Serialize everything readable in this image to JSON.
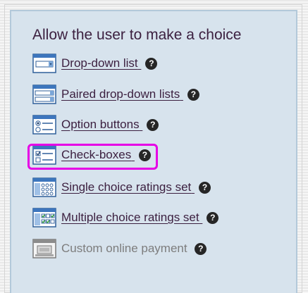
{
  "panel": {
    "title": "Allow the user to make a choice"
  },
  "items": [
    {
      "label": "Drop-down list",
      "icon": "drop-down-list-icon",
      "enabled": true,
      "highlighted": false
    },
    {
      "label": "Paired drop-down lists",
      "icon": "paired-drop-down-lists-icon",
      "enabled": true,
      "highlighted": false
    },
    {
      "label": "Option buttons",
      "icon": "option-buttons-icon",
      "enabled": true,
      "highlighted": false
    },
    {
      "label": "Check-boxes",
      "icon": "check-boxes-icon",
      "enabled": true,
      "highlighted": true
    },
    {
      "label": "Single choice ratings set",
      "icon": "single-choice-ratings-set-icon",
      "enabled": true,
      "highlighted": false
    },
    {
      "label": "Multiple choice ratings set",
      "icon": "multiple-choice-ratings-set-icon",
      "enabled": true,
      "highlighted": false
    },
    {
      "label": "Custom online payment",
      "icon": "custom-online-payment-icon",
      "enabled": false,
      "highlighted": false
    }
  ],
  "help_icon": {
    "glyph": "?",
    "icon": "question-circle-icon"
  },
  "colors": {
    "panel_background": "#d7e3ed",
    "panel_border": "#b3c9da",
    "text": "#3b1f3f",
    "disabled_text": "#7d7d7d",
    "highlight": "#e600e6"
  }
}
